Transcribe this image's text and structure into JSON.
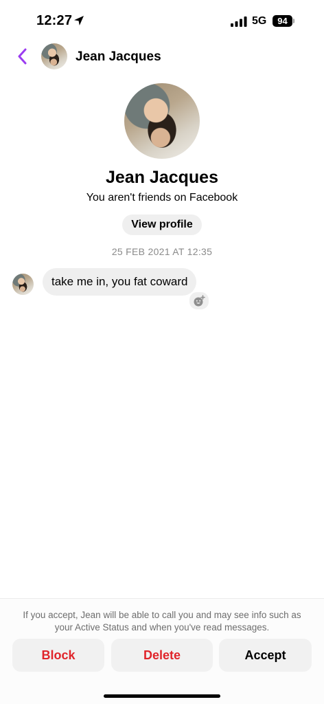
{
  "status_bar": {
    "time": "12:27",
    "network": "5G",
    "battery": "94"
  },
  "header": {
    "name": "Jean Jacques"
  },
  "profile": {
    "name": "Jean Jacques",
    "subtitle": "You aren't friends on Facebook",
    "view_profile_label": "View profile"
  },
  "conversation": {
    "timestamp": "25 FEB 2021 AT 12:35",
    "messages": [
      {
        "text": "take me in, you fat coward"
      }
    ]
  },
  "request_bar": {
    "info": "If you accept, Jean will be able to call you and may see info such as your Active Status and when you've read messages.",
    "block_label": "Block",
    "delete_label": "Delete",
    "accept_label": "Accept"
  },
  "colors": {
    "accent": "#9b3cf0",
    "danger": "#e0242a",
    "bubble": "#efefef"
  },
  "icons": [
    "location-arrow-icon",
    "signal-icon",
    "battery-icon",
    "back-chevron-icon",
    "add-reaction-icon"
  ]
}
